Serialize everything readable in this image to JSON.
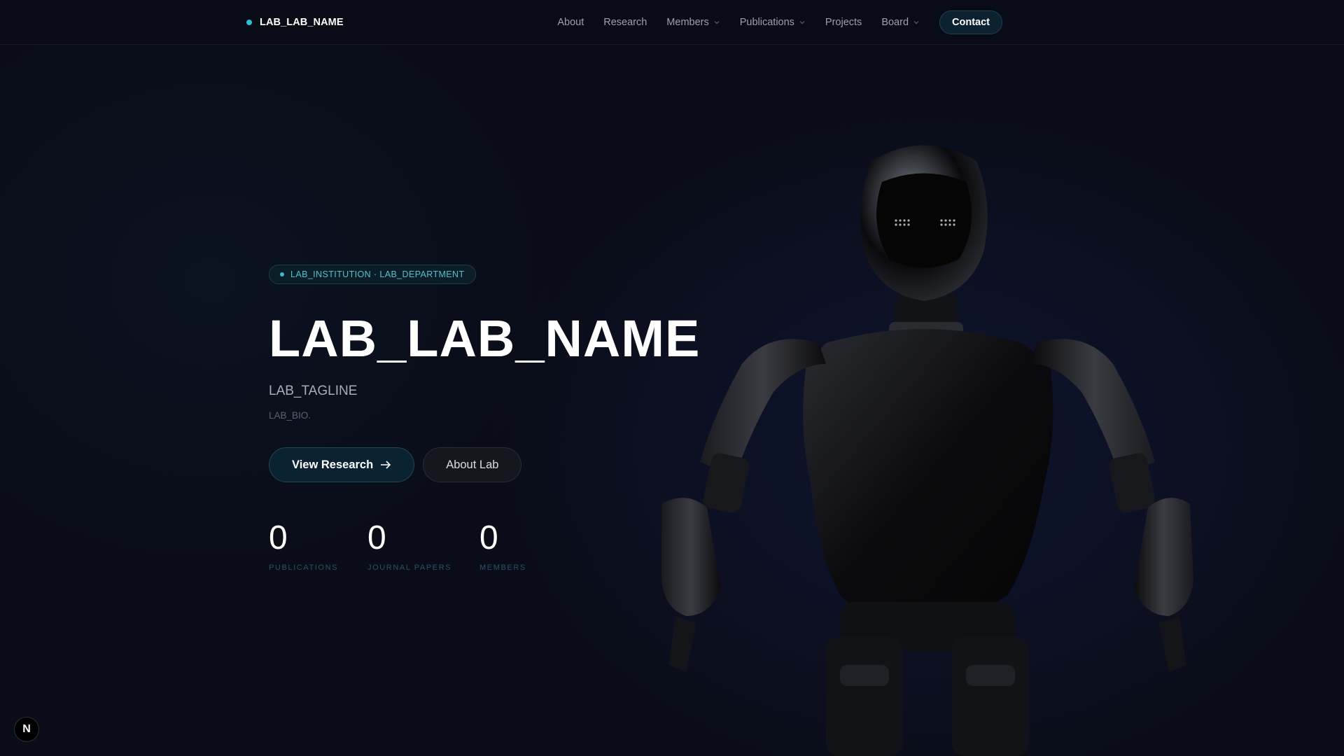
{
  "brand": {
    "name": "LAB_LAB_NAME",
    "dot_color": "#22c3d6"
  },
  "nav": {
    "links": [
      {
        "label": "About",
        "dropdown": false
      },
      {
        "label": "Research",
        "dropdown": false
      },
      {
        "label": "Members",
        "dropdown": true
      },
      {
        "label": "Publications",
        "dropdown": true
      },
      {
        "label": "Projects",
        "dropdown": false
      },
      {
        "label": "Board",
        "dropdown": true
      }
    ],
    "contact_label": "Contact"
  },
  "hero": {
    "tag": "LAB_INSTITUTION · LAB_DEPARTMENT",
    "title": "LAB_LAB_NAME",
    "tagline": "LAB_TAGLINE",
    "bio": "LAB_BIO.",
    "primary_button": "View Research",
    "primary_button_icon": "arrow-right-icon",
    "secondary_button": "About Lab",
    "stats": [
      {
        "value": "0",
        "label": "PUBLICATIONS"
      },
      {
        "value": "0",
        "label": "JOURNAL PAPERS"
      },
      {
        "value": "0",
        "label": "MEMBERS"
      }
    ]
  },
  "floating_badge": {
    "letter": "N",
    "icon": "nextjs-icon"
  },
  "colors": {
    "accent": "#22c3d6",
    "background": "#0a0d18"
  }
}
